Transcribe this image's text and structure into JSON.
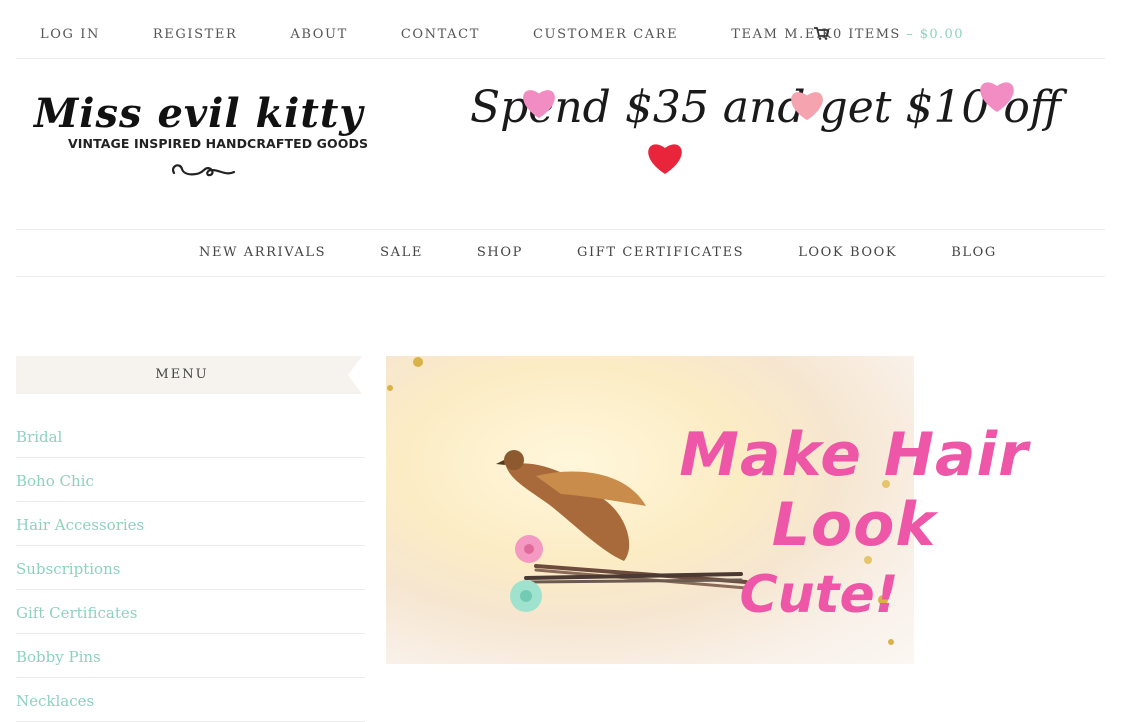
{
  "topnav": {
    "items": [
      "LOG IN",
      "REGISTER",
      "ABOUT",
      "CONTACT",
      "CUSTOMER CARE",
      "TEAM M.E.K"
    ],
    "cart_count": "0 ITEMS",
    "cart_separator": " – ",
    "cart_total": "$0.00"
  },
  "logo": {
    "name": "Miss evil kitty",
    "tagline": "VINTAGE INSPIRED HANDCRAFTED GOODS"
  },
  "promo": {
    "text": "Spend $35 and get $10 off"
  },
  "mainnav": {
    "items": [
      "NEW ARRIVALS",
      "SALE",
      "SHOP",
      "GIFT CERTIFICATES",
      "LOOK BOOK",
      "BLOG"
    ]
  },
  "sidebar": {
    "title": "MENU",
    "links": [
      "Bridal",
      "Boho Chic",
      "Hair Accessories",
      "Subscriptions",
      "Gift Certificates",
      "Bobby Pins",
      "Necklaces"
    ]
  },
  "hero": {
    "line1": "Make Hair Look",
    "line2": "Cute!"
  },
  "colors": {
    "accent": "#8fd1bd",
    "pink": "#ee56a7",
    "heart_red": "#e8253a",
    "heart_pink": "#f28dc4",
    "menu_bg": "#f6f3ee"
  }
}
